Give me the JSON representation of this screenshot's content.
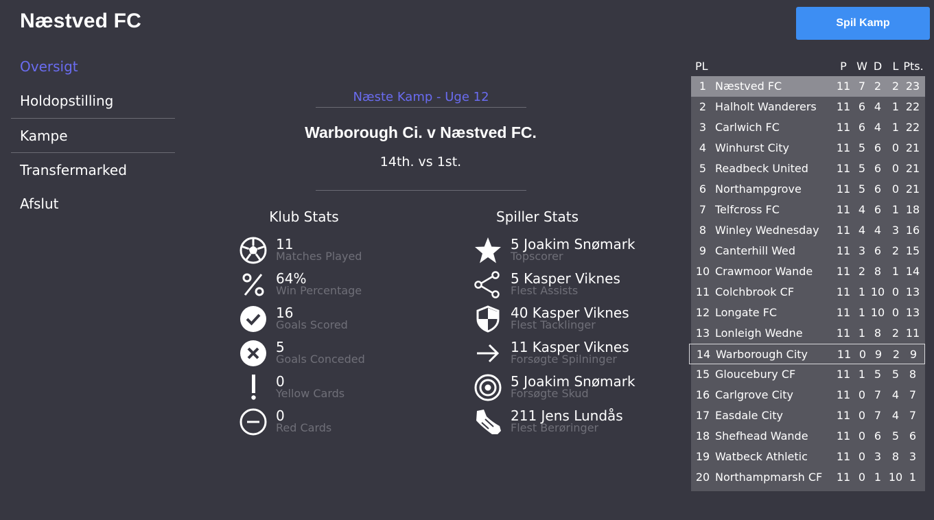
{
  "header": {
    "title": "Næstved FC",
    "play_button": "Spil Kamp"
  },
  "nav": {
    "items": [
      {
        "label": "Oversigt",
        "active": true
      },
      {
        "label": "Holdopstilling"
      },
      {
        "label": "Kampe"
      },
      {
        "label": "Transfermarked"
      },
      {
        "label": "Afslut"
      }
    ]
  },
  "match": {
    "next_label": "Næste Kamp - Uge 12",
    "fixture": "Warborough Ci. v Næstved FC.",
    "positions": "14th. vs 1st."
  },
  "club_stats": {
    "heading": "Klub Stats",
    "items": [
      {
        "icon": "soccer-ball-icon",
        "value": "11",
        "label": "Matches Played"
      },
      {
        "icon": "percent-icon",
        "value": "64%",
        "label": "Win Percentage"
      },
      {
        "icon": "check-circle-icon",
        "value": "16",
        "label": "Goals Scored"
      },
      {
        "icon": "x-circle-icon",
        "value": "5",
        "label": "Goals Conceded"
      },
      {
        "icon": "exclamation-icon",
        "value": "0",
        "label": "Yellow Cards"
      },
      {
        "icon": "minus-circle-icon",
        "value": "0",
        "label": "Red Cards"
      }
    ]
  },
  "player_stats": {
    "heading": "Spiller Stats",
    "items": [
      {
        "icon": "star-icon",
        "value": "5 Joakim Snømark",
        "label": "Topscorer"
      },
      {
        "icon": "share-icon",
        "value": "5 Kasper Viknes",
        "label": "Flest Assists"
      },
      {
        "icon": "shield-icon",
        "value": "40 Kasper Viknes",
        "label": "Flest Tacklinger"
      },
      {
        "icon": "arrow-right-icon",
        "value": "11 Kasper Viknes",
        "label": "Forsøgte Spilninger"
      },
      {
        "icon": "target-icon",
        "value": "5 Joakim Snømark",
        "label": "Forsøgte Skud"
      },
      {
        "icon": "boot-icon",
        "value": "211 Jens Lundås",
        "label": "Flest Berøringer"
      }
    ]
  },
  "league_table": {
    "columns": {
      "pl": "PL",
      "p": "P",
      "w": "W",
      "d": "D",
      "l": "L",
      "pts": "Pts."
    },
    "rows": [
      {
        "pl": "1",
        "team": "Næstved FC",
        "p": "11",
        "w": "7",
        "d": "2",
        "l": "2",
        "pts": "23"
      },
      {
        "pl": "2",
        "team": "Halholt Wanderers",
        "p": "11",
        "w": "6",
        "d": "4",
        "l": "1",
        "pts": "22"
      },
      {
        "pl": "3",
        "team": "Carlwich FC",
        "p": "11",
        "w": "6",
        "d": "4",
        "l": "1",
        "pts": "22"
      },
      {
        "pl": "4",
        "team": "Winhurst City",
        "p": "11",
        "w": "5",
        "d": "6",
        "l": "0",
        "pts": "21"
      },
      {
        "pl": "5",
        "team": "Readbeck United",
        "p": "11",
        "w": "5",
        "d": "6",
        "l": "0",
        "pts": "21"
      },
      {
        "pl": "6",
        "team": "Northampgrove",
        "p": "11",
        "w": "5",
        "d": "6",
        "l": "0",
        "pts": "21"
      },
      {
        "pl": "7",
        "team": "Telfcross FC",
        "p": "11",
        "w": "4",
        "d": "6",
        "l": "1",
        "pts": "18"
      },
      {
        "pl": "8",
        "team": "Winley Wednesday",
        "p": "11",
        "w": "4",
        "d": "4",
        "l": "3",
        "pts": "16"
      },
      {
        "pl": "9",
        "team": "Canterhill Wed",
        "p": "11",
        "w": "3",
        "d": "6",
        "l": "2",
        "pts": "15"
      },
      {
        "pl": "10",
        "team": "Crawmoor Wande",
        "p": "11",
        "w": "2",
        "d": "8",
        "l": "1",
        "pts": "14"
      },
      {
        "pl": "11",
        "team": "Colchbrook CF",
        "p": "11",
        "w": "1",
        "d": "10",
        "l": "0",
        "pts": "13"
      },
      {
        "pl": "12",
        "team": "Longate FC",
        "p": "11",
        "w": "1",
        "d": "10",
        "l": "0",
        "pts": "13"
      },
      {
        "pl": "13",
        "team": "Lonleigh Wedne",
        "p": "11",
        "w": "1",
        "d": "8",
        "l": "2",
        "pts": "11"
      },
      {
        "pl": "14",
        "team": "Warborough City",
        "p": "11",
        "w": "0",
        "d": "9",
        "l": "2",
        "pts": "9"
      },
      {
        "pl": "15",
        "team": "Gloucebury CF",
        "p": "11",
        "w": "1",
        "d": "5",
        "l": "5",
        "pts": "8"
      },
      {
        "pl": "16",
        "team": "Carlgrove City",
        "p": "11",
        "w": "0",
        "d": "7",
        "l": "4",
        "pts": "7"
      },
      {
        "pl": "17",
        "team": "Easdale City",
        "p": "11",
        "w": "0",
        "d": "7",
        "l": "4",
        "pts": "7"
      },
      {
        "pl": "18",
        "team": "Shefhead Wande",
        "p": "11",
        "w": "0",
        "d": "6",
        "l": "5",
        "pts": "6"
      },
      {
        "pl": "19",
        "team": "Watbeck Athletic",
        "p": "11",
        "w": "0",
        "d": "3",
        "l": "8",
        "pts": "3"
      },
      {
        "pl": "20",
        "team": "Northampmarsh CF",
        "p": "11",
        "w": "0",
        "d": "1",
        "l": "10",
        "pts": "1"
      }
    ]
  }
}
